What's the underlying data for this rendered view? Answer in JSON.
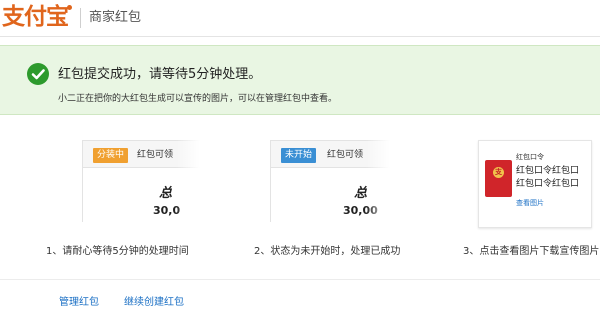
{
  "header": {
    "logo": "支付宝",
    "title": "商家红包"
  },
  "banner": {
    "title": "红包提交成功，请等待5分钟处理。",
    "subtitle": "小二正在把你的大红包生成可以宣传的图片，可以在管理红包中查看。",
    "color": "#2d9a2d"
  },
  "steps": [
    {
      "badge": "分装中",
      "badge_color": "#f0a030",
      "card_label": "红包可领",
      "total_label": "总",
      "amount": "30,0",
      "caption": "1、请耐心等待5分钟的处理时间"
    },
    {
      "badge": "未开始",
      "badge_color": "#3a8fd4",
      "card_label": "红包可领",
      "total_label": "总",
      "amount": "30,00",
      "caption": "2、状态为未开始时，处理已成功"
    },
    {
      "poster_title": "红包口令",
      "poster_lines": [
        "红包口令红包口",
        "红包口令红包口"
      ],
      "poster_link": "查看图片",
      "caption": "3、点击查看图片下载宣传图片"
    }
  ],
  "links": {
    "manage": "管理红包",
    "create": "继续创建红包"
  }
}
